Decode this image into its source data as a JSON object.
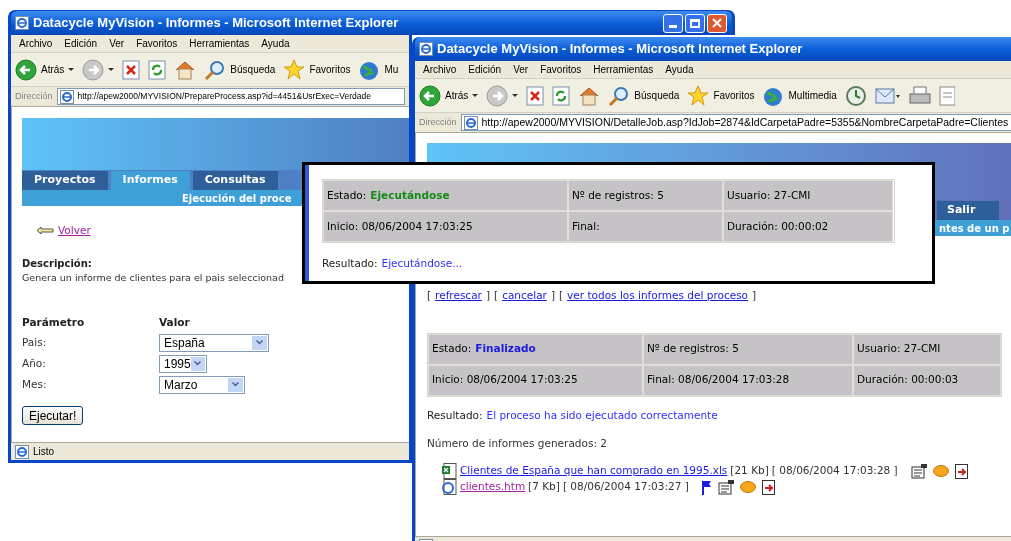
{
  "left_window": {
    "title": "Datacycle MyVision - Informes - Microsoft Internet Explorer",
    "menu": [
      "Archivo",
      "Edición",
      "Ver",
      "Favoritos",
      "Herramientas",
      "Ayuda"
    ],
    "toolbar": [
      {
        "kind": "back",
        "label": "Atrás"
      },
      {
        "kind": "forward"
      },
      {
        "kind": "stop"
      },
      {
        "kind": "refresh"
      },
      {
        "kind": "home"
      },
      {
        "kind": "search",
        "label": "Búsqueda"
      },
      {
        "kind": "favorites",
        "label": "Favoritos"
      },
      {
        "kind": "media",
        "label": "Mu"
      }
    ],
    "address": {
      "label": "Dirección",
      "url": "http://apew2000/MYVISION/PrepareProcess.asp?id=4451&UsrExec=Verdade"
    },
    "tabs": [
      {
        "label": "Proyectos",
        "selected": false
      },
      {
        "label": "Informes",
        "selected": true
      },
      {
        "label": "Consultas",
        "selected": false
      }
    ],
    "subtitle": "Ejecución del proce",
    "back_link": "Volver",
    "description_label": "Descripción:",
    "description": "Genera un informe de clientes para el pais seleccionad",
    "param_headers": [
      "Parámetro",
      "Valor"
    ],
    "params": [
      {
        "label": "Pais:",
        "value": "España"
      },
      {
        "label": "Año:",
        "value": "1995"
      },
      {
        "label": "Mes:",
        "value": "Marzo"
      }
    ],
    "button": "Ejecutar!",
    "status": "Listo"
  },
  "right_window": {
    "title": "Datacycle MyVision - Informes - Microsoft Internet Explorer",
    "menu": [
      "Archivo",
      "Edición",
      "Ver",
      "Favoritos",
      "Herramientas",
      "Ayuda"
    ],
    "toolbar": [
      {
        "kind": "back",
        "label": "Atrás"
      },
      {
        "kind": "forward"
      },
      {
        "kind": "stop"
      },
      {
        "kind": "refresh"
      },
      {
        "kind": "home"
      },
      {
        "kind": "search",
        "label": "Búsqueda"
      },
      {
        "kind": "favorites",
        "label": "Favoritos"
      },
      {
        "kind": "media",
        "label": "Multimedia"
      },
      {
        "kind": "history"
      },
      {
        "kind": "mail"
      },
      {
        "kind": "print"
      },
      {
        "kind": "edit"
      }
    ],
    "address": {
      "label": "Dirección",
      "url": "http://apew2000/MYVISION/DetalleJob.asp?IdJob=2874&IdCarpetaPadre=5355&NombreCarpetaPadre=Clientes"
    },
    "tab": "Salir",
    "subtitle": "ntes de un p",
    "open_bracket": "[",
    "close_bracket": "]",
    "links": [
      "refrescar",
      "cancelar",
      "ver todos los informes del proceso"
    ],
    "job": {
      "status_label": "Estado:",
      "status": "Finalizado",
      "finished": true,
      "cells": [
        "Nº de registros: 5",
        "Usuario: 27-CMI",
        "Inicio: 08/06/2004 17:03:25",
        "Final: 08/06/2004 17:03:28",
        "Duración: 00:00:03"
      ]
    },
    "result_label": "Resultado:",
    "result": "El proceso ha sido ejecutado correctamente",
    "count": "Número de informes generados: 2",
    "files": [
      {
        "kind": "excel",
        "name": "Clientes de España que han comprado en 1995.xls",
        "visited": false,
        "size": "[21 Kb]",
        "date": "[ 08/06/2004 17:03:28 ]",
        "actions": [
          {
            "kind": "properties"
          },
          {
            "kind": "favorite"
          },
          {
            "kind": "export"
          }
        ]
      },
      {
        "kind": "html",
        "name": "clientes.htm",
        "visited": true,
        "size": "[7 Kb]",
        "date": "[ 08/06/2004 17:03:27 ]",
        "actions": [
          {
            "kind": "flag"
          },
          {
            "kind": "properties"
          },
          {
            "kind": "favorite"
          },
          {
            "kind": "export"
          }
        ]
      }
    ]
  },
  "callout": {
    "job": {
      "status_label": "Estado:",
      "status": "Ejecutándose",
      "finished": false,
      "cells": [
        "Nº de registros: 5",
        "Usuario: 27-CMI",
        "Inicio: 08/06/2004 17:03:25",
        "Final:",
        "Duración: 00:00:02"
      ]
    },
    "result_label": "Resultado:",
    "result": "Ejecutándose..."
  }
}
